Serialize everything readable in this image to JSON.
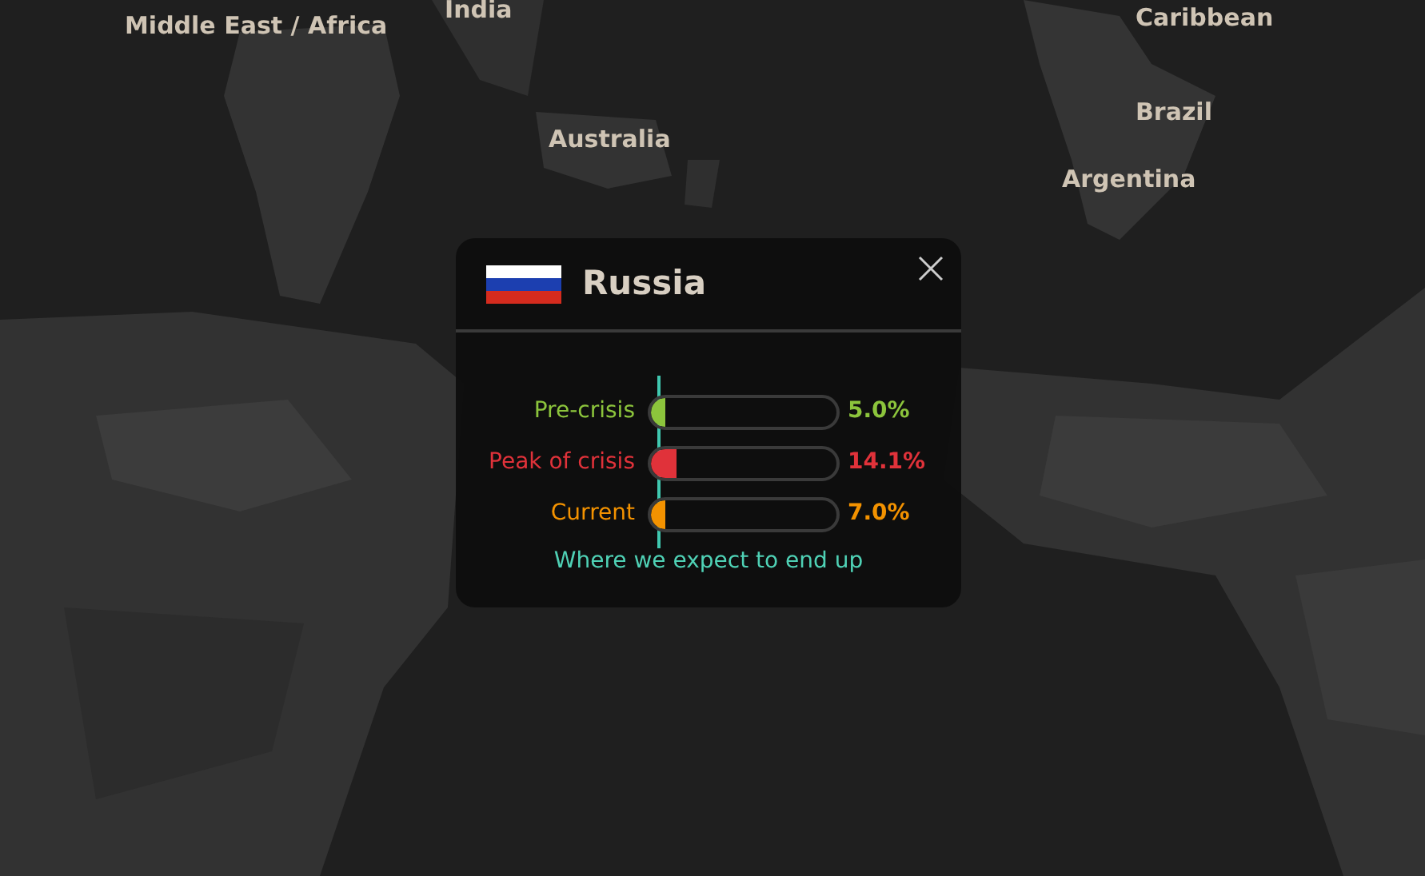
{
  "map_labels": [
    {
      "text": "Middle East / Africa"
    },
    {
      "text": "India"
    },
    {
      "text": "Australia"
    },
    {
      "text": "Caribbean"
    },
    {
      "text": "Brazil"
    },
    {
      "text": "Argentina"
    }
  ],
  "popup": {
    "country": "Russia",
    "rows": [
      {
        "label": "Pre-crisis",
        "level": 0.05,
        "reading": "5.0%",
        "color": "#8cc43c"
      },
      {
        "label": "Peak of crisis",
        "level": 0.141,
        "reading": "14.1%",
        "color": "#e0323a"
      },
      {
        "label": "Current",
        "level": 0.07,
        "reading": "7.0%",
        "color": "#f39200"
      }
    ],
    "note": "Where we expect to end up"
  }
}
